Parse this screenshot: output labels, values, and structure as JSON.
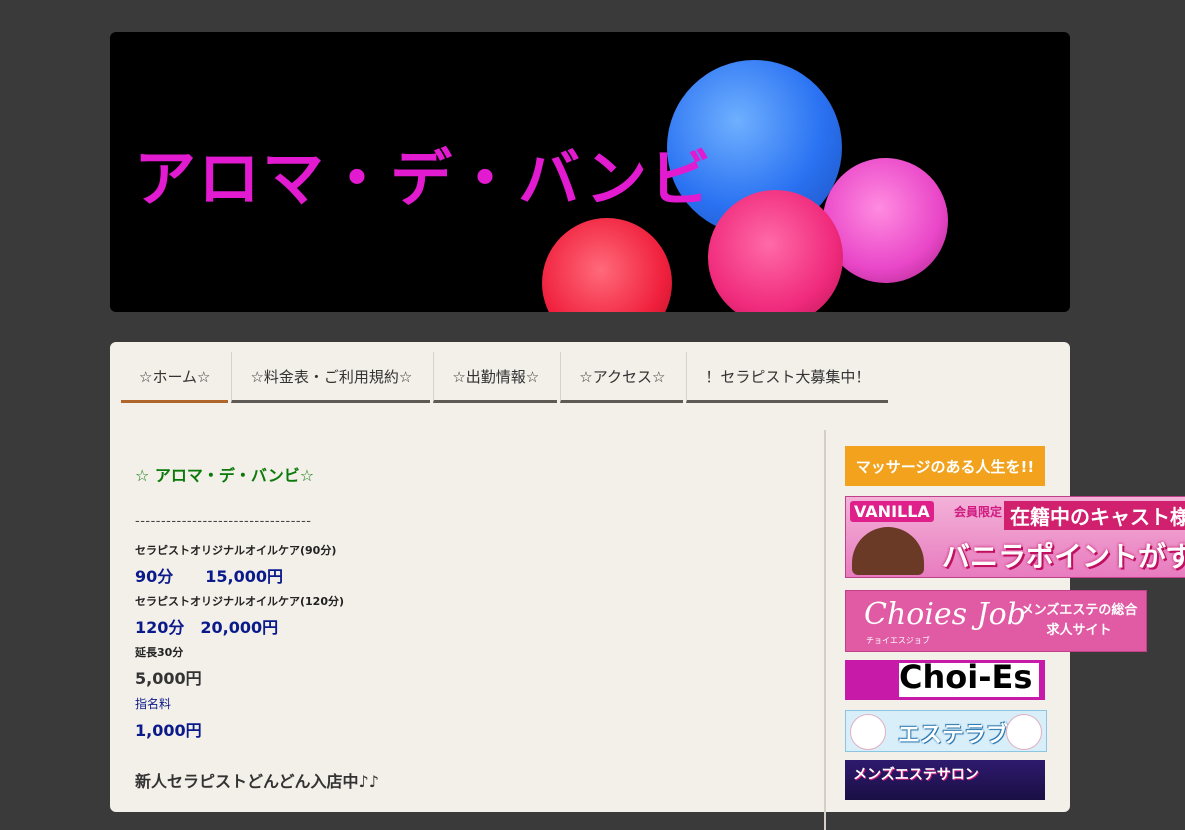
{
  "header": {
    "site_title": "アロマ・デ・バンビ"
  },
  "nav": {
    "items": [
      {
        "label": "☆ホーム☆",
        "active": true
      },
      {
        "label": "☆料金表・ご利用規約☆"
      },
      {
        "label": "☆出勤情報☆"
      },
      {
        "label": "☆アクセス☆"
      },
      {
        "label": "！セラピスト大募集中！"
      }
    ]
  },
  "content": {
    "title": "☆ アロマ・デ・バンビ☆",
    "dashes": "----------------------------------",
    "menu": [
      {
        "label": "セラピストオリジナルオイルケア(90分)",
        "price": "90分　　15,000円"
      },
      {
        "label": "セラピストオリジナルオイルケア(120分)",
        "price": "120分　20,000円"
      },
      {
        "label": "延長30分",
        "price": "5,000円"
      },
      {
        "label": "指名料",
        "price": "1,000円"
      }
    ],
    "recruit_line": "新人セラピストどんどん入店中♪♪"
  },
  "sidebar": {
    "banner1_text": "マッサージのある人生を!!",
    "banner2": {
      "brand": "VANILLA",
      "limit": "会員限定",
      "line1": "在籍中のキャスト様",
      "line2": "バニラポイントがずっと"
    },
    "banner3": {
      "logo": "Choies Job",
      "sub": "チョイエスジョブ",
      "desc": "メンズエステの総合求人サイト"
    },
    "banner4_text": "Choi-Es",
    "banner5_text": "エステラブ",
    "banner6_text": "メンズエステサロン"
  },
  "colors": {
    "page_bg": "#3a3a3a",
    "title_magenta": "#e21ad0",
    "panel_bg": "#f3efe9",
    "nav_active_underline": "#b0652a",
    "heading_green": "#0b7a0b",
    "price_blue": "#0a1a8a"
  }
}
